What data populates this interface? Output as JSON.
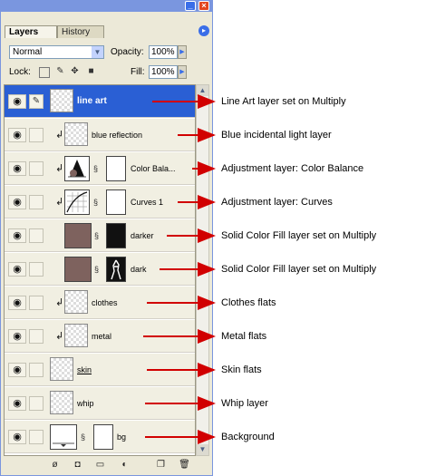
{
  "panel": {
    "tabs": [
      {
        "label": "Layers"
      },
      {
        "label": "History"
      }
    ],
    "blend_mode": "Normal",
    "opacity_label": "Opacity:",
    "opacity_value": "100%",
    "lock_label": "Lock:",
    "fill_label": "Fill:",
    "fill_value": "100%"
  },
  "layers": [
    {
      "name": "line art",
      "selected": true
    },
    {
      "name": "blue reflection"
    },
    {
      "name": "Color Bala..."
    },
    {
      "name": "Curves 1"
    },
    {
      "name": "darker"
    },
    {
      "name": "dark"
    },
    {
      "name": "clothes"
    },
    {
      "name": "metal"
    },
    {
      "name": "skin"
    },
    {
      "name": "whip"
    },
    {
      "name": "bg"
    }
  ],
  "annotations": [
    "Line Art layer set on Multiply",
    "Blue incidental light layer",
    "Adjustment layer: Color Balance",
    "Adjustment layer: Curves",
    "Solid Color Fill layer set on Multiply",
    "Solid Color Fill layer set on Multiply",
    "Clothes flats",
    "Metal flats",
    "Skin flats",
    "Whip layer",
    "Background"
  ],
  "colors": {
    "selection": "#2a5fd4",
    "arrow": "#d10000",
    "fill_swatch": "#7e625e"
  },
  "icons": [
    "eye-icon",
    "brush-icon",
    "chain-link-icon",
    "clip-arrow-icon",
    "lock-icon",
    "move-icon",
    "trash-icon",
    "new-layer-icon"
  ]
}
